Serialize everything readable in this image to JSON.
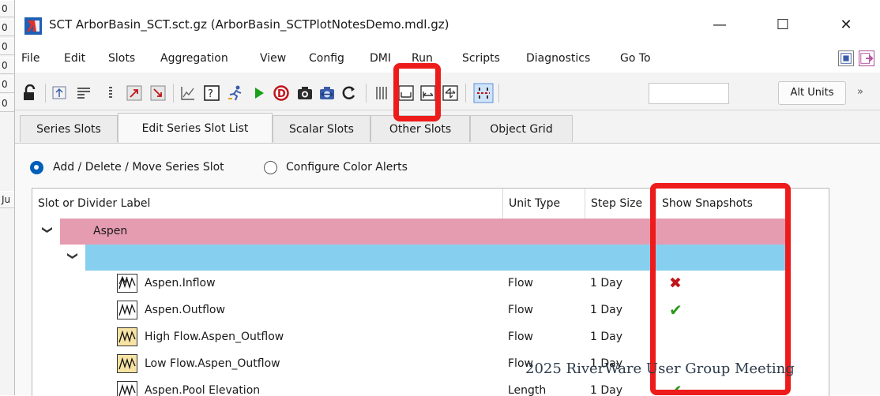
{
  "background_window": {
    "cells": [
      "0",
      "0",
      "0",
      "0",
      "0",
      "0",
      "Ju"
    ]
  },
  "title": "SCT ArborBasin_SCT.sct.gz (ArborBasin_SCTPlotNotesDemo.mdl.gz)",
  "window_controls": {
    "minimize": "—",
    "maximize": "☐",
    "close": "✕"
  },
  "menu": [
    "File",
    "Edit",
    "Slots",
    "Aggregation",
    "View",
    "Config",
    "DMI",
    "Run",
    "Scripts",
    "Diagnostics",
    "Go To"
  ],
  "toolbar": {
    "alt_units_label": "Alt Units",
    "more_label": "»",
    "input_value": ""
  },
  "tabs": [
    "Series Slots",
    "Edit Series Slot List",
    "Scalar Slots",
    "Other Slots",
    "Object Grid"
  ],
  "active_tab_index": 1,
  "mode": {
    "option_1": "Add / Delete / Move Series Slot",
    "option_2": "Configure Color Alerts",
    "selected": 1
  },
  "table": {
    "headers": [
      "Slot or Divider Label",
      "Unit Type",
      "Step Size",
      "Show Snapshots"
    ],
    "divider_1_label": "Aspen",
    "rows": [
      {
        "label": "Aspen.Inflow",
        "unit": "Flow",
        "step": "1 Day",
        "snapshot": "✖"
      },
      {
        "label": "Aspen.Outflow",
        "unit": "Flow",
        "step": "1 Day",
        "snapshot": "✔"
      },
      {
        "label": "High Flow.Aspen_Outflow",
        "unit": "Flow",
        "step": "1 Day",
        "snapshot": ""
      },
      {
        "label": "Low Flow.Aspen_Outflow",
        "unit": "Flow",
        "step": "1 Day",
        "snapshot": ""
      },
      {
        "label": "Aspen.Pool Elevation",
        "unit": "Length",
        "step": "1 Day",
        "snapshot": "✔"
      }
    ]
  },
  "colors": {
    "divider_pink": "#e59bb0",
    "divider_blue": "#87cfee",
    "highlight_red": "#ee1b1b",
    "check_green": "#2a9a1a",
    "x_red": "#c0141a"
  },
  "watermark": "2025 RiverWare User Group Meeting"
}
